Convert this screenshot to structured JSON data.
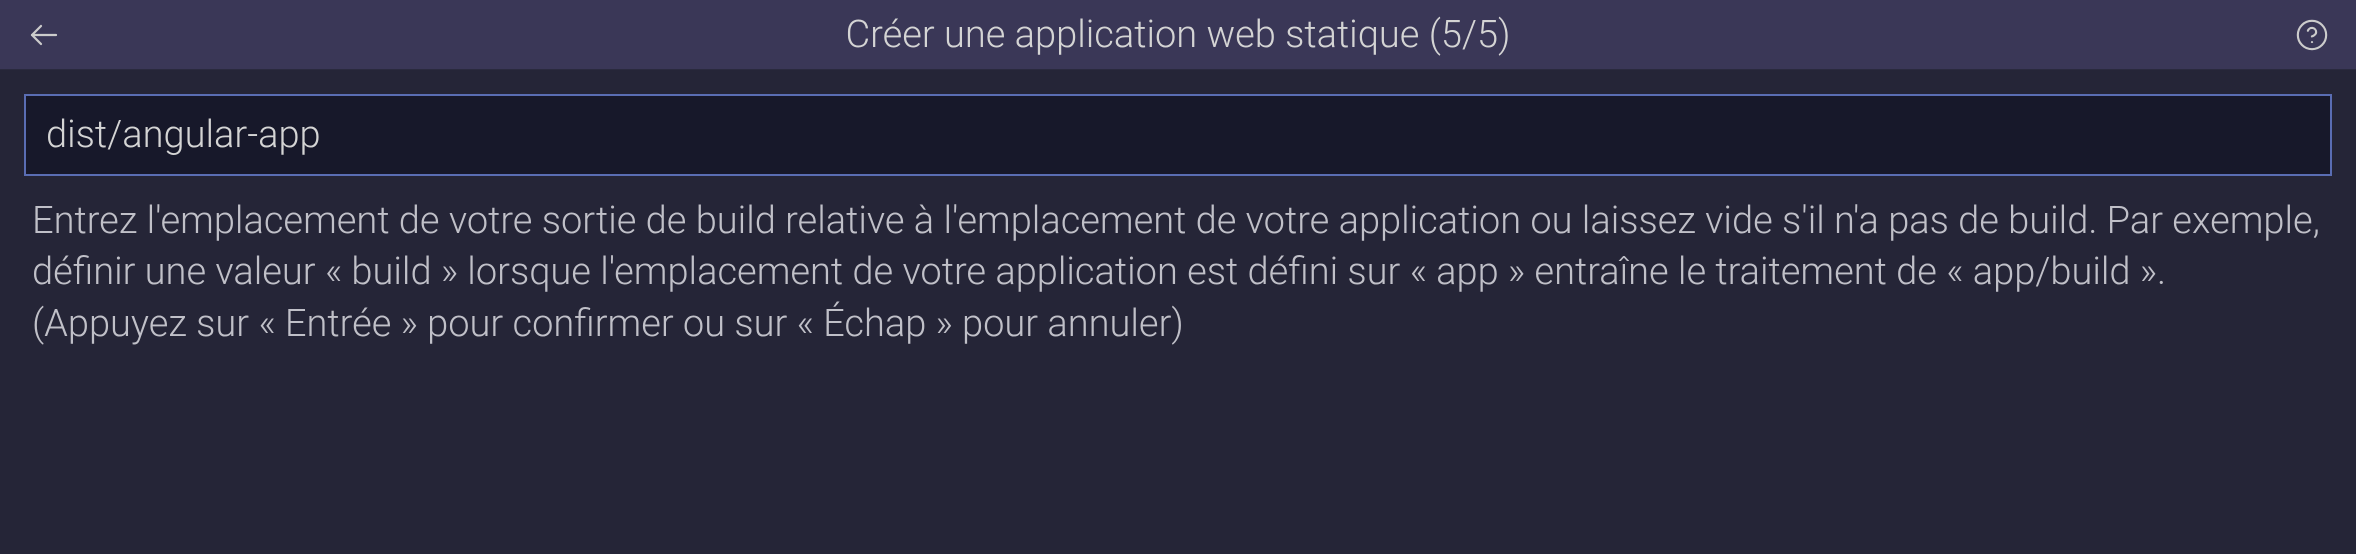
{
  "header": {
    "title": "Créer une application web statique (5/5)"
  },
  "input": {
    "value": "dist/angular-app"
  },
  "description": {
    "text": "Entrez l'emplacement de votre sortie de build relative à l'emplacement de votre application ou laissez vide s'il n'a pas de build. Par exemple, définir une valeur « build » lorsque l'emplacement de votre application est défini sur « app » entraîne le traitement de « app/build ». (Appuyez sur « Entrée » pour confirmer ou sur « Échap » pour annuler)"
  }
}
